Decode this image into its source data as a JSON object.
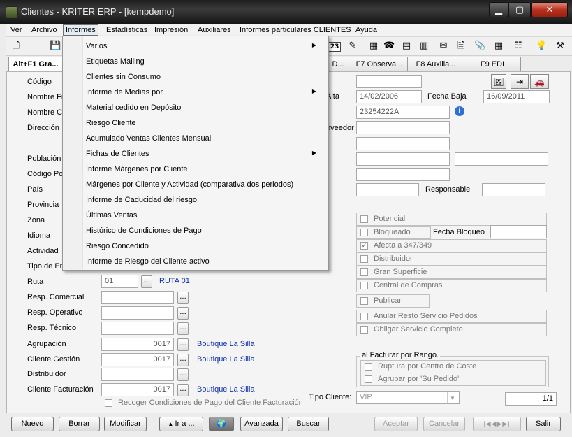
{
  "window": {
    "title": "Clientes - KRITER ERP - [kempdemo]"
  },
  "menubar": [
    "Ver",
    "Archivo",
    "Informes",
    "Estadísticas",
    "Impresión",
    "Auxiliares",
    "Informes particulares CLIENTES",
    "Ayuda"
  ],
  "informes_menu": [
    {
      "label": "Varios",
      "submenu": true
    },
    {
      "label": "Etiquetas Mailing",
      "submenu": false
    },
    {
      "label": "Clientes sin Consumo",
      "submenu": false
    },
    {
      "label": "Informe de Medias por",
      "submenu": true
    },
    {
      "label": "Material cedido en Depósito",
      "submenu": false
    },
    {
      "label": "Riesgo Cliente",
      "submenu": false
    },
    {
      "label": "Acumulado Ventas Clientes Mensual",
      "submenu": false
    },
    {
      "label": "Fichas de Clientes",
      "submenu": true
    },
    {
      "label": "Informe Márgenes por Cliente",
      "submenu": false
    },
    {
      "label": "Márgenes por Cliente y Actividad (comparativa dos periodos)",
      "submenu": false
    },
    {
      "label": "Informe de Caducidad del riesgo",
      "submenu": false
    },
    {
      "label": "Últimas Ventas",
      "submenu": false
    },
    {
      "label": "Histórico de Condiciones de Pago",
      "submenu": false
    },
    {
      "label": "Riesgo Concedido",
      "submenu": false
    },
    {
      "label": "Informe de Riesgo del Cliente activo",
      "submenu": false
    }
  ],
  "tabs": [
    "Alt+F1 Gra...",
    "D...",
    "F7 Observa...",
    "F8 Auxilia...",
    "F9 EDI"
  ],
  "labels": {
    "codigo": "Código",
    "nombre_fiscal": "Nombre Fi",
    "nombre_comercial": "Nombre Co",
    "direccion": "Dirección",
    "poblacion": "Población",
    "codigo_postal": "Código Po",
    "pais": "País",
    "provincia": "Provincia",
    "zona": "Zona",
    "idioma": "Idioma",
    "actividad": "Actividad",
    "tipo_envio": "Tipo de En",
    "ruta": "Ruta",
    "resp_comercial": "Resp. Comercial",
    "resp_operativo": "Resp. Operativo",
    "resp_tecnico": "Resp. Técnico",
    "agrupacion": "Agrupación",
    "cliente_gestion": "Cliente Gestión",
    "distribuidor": "Distribuidor",
    "cliente_facturacion": "Cliente Facturación",
    "alta": "Alta",
    "fecha_baja": "Fecha Baja",
    "proveedor": "oveedor",
    "responsable": "Responsable",
    "fecha_bloqueo": "Fecha Bloqueo",
    "facturar_rango": "al Facturar por Rango.",
    "tipo_cliente": "Tipo Cliente:"
  },
  "values": {
    "fecha_alta": "14/02/2006",
    "fecha_baja": "16/09/2011",
    "nif": "23254222A",
    "ruta_code": "01",
    "ruta_name": "RUTA 01",
    "agrupacion_code": "0017",
    "agrupacion_name": "Boutique La Silla",
    "cliente_gestion_code": "0017",
    "cliente_gestion_name": "Boutique La Silla",
    "cliente_facturacion_code": "0017",
    "cliente_facturacion_name": "Boutique La Silla",
    "tipo_cliente": "VIP",
    "record_pos": "1/1",
    "dots": "..."
  },
  "checks": [
    {
      "label": "Potencial",
      "checked": false
    },
    {
      "label": "Bloqueado",
      "checked": false
    },
    {
      "label": "Afecta a 347/349",
      "checked": true
    },
    {
      "label": "Distribuidor",
      "checked": false
    },
    {
      "label": "Gran Superficie",
      "checked": false
    },
    {
      "label": "Central de Compras",
      "checked": false
    },
    {
      "label": "Publicar",
      "checked": false
    },
    {
      "label": "Anular Resto Servicio Pedidos",
      "checked": false
    },
    {
      "label": "Obligar Servicio Completo",
      "checked": false
    },
    {
      "label": "Ruptura por Centro de Coste",
      "checked": false
    },
    {
      "label": "Agrupar por 'Su Pedido'",
      "checked": false
    },
    {
      "label": "Recoger Condiciones de Pago del Cliente Facturación",
      "checked": false
    }
  ],
  "buttons": {
    "nuevo": "Nuevo",
    "borrar": "Borrar",
    "modificar": "Modificar",
    "ir_a": "Ir a ...",
    "avanzada": "Avanzada",
    "buscar": "Buscar",
    "aceptar": "Aceptar",
    "cancelar": "Cancelar",
    "salir": "Salir"
  },
  "toolbar": {
    "counter_icon": "123"
  }
}
